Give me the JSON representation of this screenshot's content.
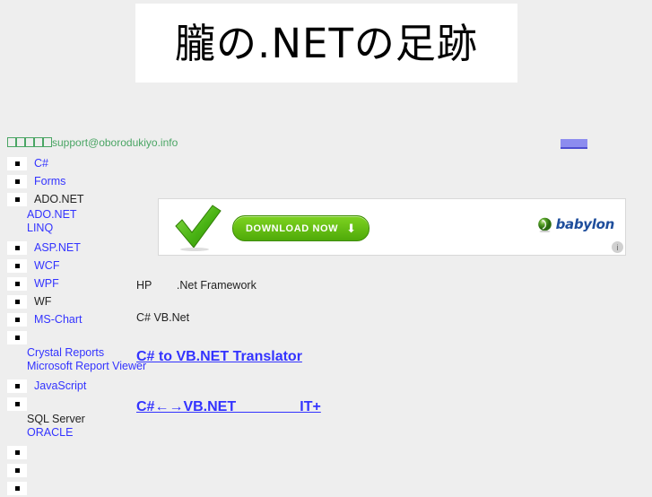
{
  "header": {
    "site_title": "朧の.NETの足跡"
  },
  "contact": {
    "prefix_missing_glyphs": 5,
    "email": "support@oborodukiyo.info",
    "color": "#4aa564"
  },
  "top_right_link": {
    "label": ""
  },
  "sidebar": {
    "groups": [
      {
        "label": "C#",
        "style": "link",
        "children": []
      },
      {
        "label": "Forms",
        "style": "link",
        "children": []
      },
      {
        "label": "ADO.NET",
        "style": "plain",
        "children": [
          {
            "label": "ADO.NET",
            "style": "link"
          },
          {
            "label": "LINQ",
            "style": "link"
          }
        ]
      },
      {
        "label": "ASP.NET",
        "style": "link",
        "children": []
      },
      {
        "label": "WCF",
        "style": "link",
        "children": []
      },
      {
        "label": "WPF",
        "style": "link",
        "children": []
      },
      {
        "label": "WF",
        "style": "plain",
        "children": []
      },
      {
        "label": "MS-Chart",
        "style": "link",
        "children": []
      },
      {
        "label": "",
        "style": "blank",
        "children": [
          {
            "label": "Crystal Reports",
            "style": "link"
          },
          {
            "label": "Microsoft Report Viewer",
            "style": "link"
          }
        ]
      },
      {
        "label": "JavaScript",
        "style": "link",
        "children": []
      },
      {
        "label": "",
        "style": "blank",
        "children": [
          {
            "label": "SQL Server",
            "style": "plain"
          },
          {
            "label": "ORACLE",
            "style": "link"
          }
        ]
      },
      {
        "label": "",
        "style": "blank",
        "children": []
      },
      {
        "label": "",
        "style": "blank",
        "children": []
      },
      {
        "label": "",
        "style": "blank",
        "children": []
      }
    ]
  },
  "ad": {
    "check_icon": "green-check-icon",
    "download_label": "DOWNLOAD NOW",
    "download_arrow": "⬇",
    "brand_name": "babylon",
    "brand_icon": "globe-icon",
    "info_badge": "i"
  },
  "main": {
    "line1": "HP        .Net Framework",
    "line2": "C# VB.Net",
    "heading1": "C# to VB.NET Translator",
    "heading2": "C#←→VB.NET                IT+"
  },
  "colors": {
    "page_background": "#eeeeee",
    "link": "#3333ff",
    "text": "#222222",
    "accent_green": "#4faa09",
    "brand_blue": "#1f4e9c"
  }
}
